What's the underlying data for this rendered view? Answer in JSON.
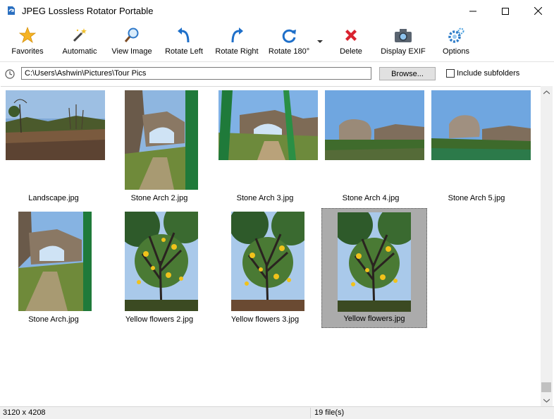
{
  "window": {
    "title": "JPEG Lossless Rotator Portable"
  },
  "toolbar": {
    "favorites": "Favorites",
    "automatic": "Automatic",
    "view_image": "View Image",
    "rotate_left": "Rotate Left",
    "rotate_right": "Rotate Right",
    "rotate_180": "Rotate 180°",
    "delete": "Delete",
    "display_exif": "Display EXIF",
    "options": "Options"
  },
  "path": {
    "value": "C:\\Users\\Ashwin\\Pictures\\Tour Pics",
    "browse_label": "Browse...",
    "include_subfolders": "Include subfolders"
  },
  "files": [
    {
      "name": "Landscape.jpg",
      "kind": "landscape"
    },
    {
      "name": "Stone Arch 2.jpg",
      "kind": "arch-portrait"
    },
    {
      "name": "Stone Arch 3.jpg",
      "kind": "arch-land"
    },
    {
      "name": "Stone Arch 4.jpg",
      "kind": "rock"
    },
    {
      "name": "Stone Arch 5.jpg",
      "kind": "rock"
    },
    {
      "name": "Stone Arch.jpg",
      "kind": "arch-portrait"
    },
    {
      "name": "Yellow flowers 2.jpg",
      "kind": "tree"
    },
    {
      "name": "Yellow flowers 3.jpg",
      "kind": "tree"
    },
    {
      "name": "Yellow flowers.jpg",
      "kind": "tree",
      "selected": true
    }
  ],
  "status": {
    "dimensions": "3120 x 4208",
    "file_count": "19 file(s)"
  },
  "colors": {
    "accent_blue": "#1e6fc9",
    "delete_red": "#d9232f",
    "star": "#f5b324",
    "selection": "#ababab"
  }
}
